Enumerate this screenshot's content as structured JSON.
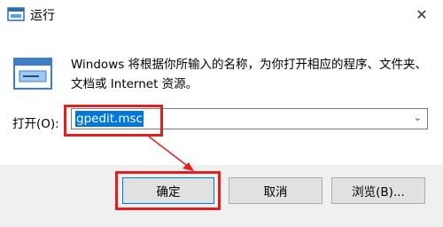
{
  "window": {
    "title": "运行",
    "close_glyph": "✕"
  },
  "description": "Windows 将根据你所输入的名称，为你打开相应的程序、文件夹、文档或 Internet 资源。",
  "open": {
    "label": "打开(O):",
    "value": "gpedit.msc",
    "dropdown_glyph": "⌄"
  },
  "buttons": {
    "ok": "确定",
    "cancel": "取消",
    "browse": "浏览(B)..."
  },
  "icons": {
    "app": "run-app-icon",
    "run": "run-dialog-icon",
    "close": "close-icon",
    "dropdown": "chevron-down-icon"
  },
  "colors": {
    "annotation_red": "#e0201c",
    "selection_blue": "#0078d7",
    "footer_bg": "#f0f0f0"
  }
}
